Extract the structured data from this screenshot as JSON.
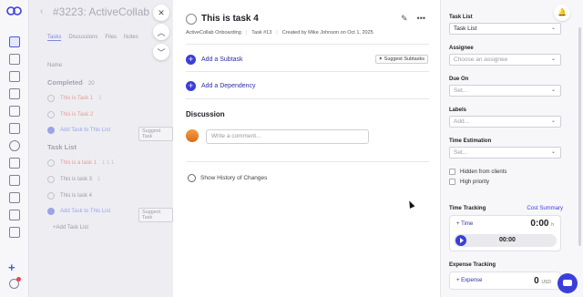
{
  "background_project": {
    "title": "#3223: ActiveCollab ...",
    "tabs": [
      "Tasks",
      "Discussions",
      "Files",
      "Notes"
    ],
    "name_header": "Name",
    "completed_group": {
      "label": "Completed",
      "count": "20"
    },
    "completed_tasks": [
      {
        "name": "This is Task 1",
        "extra": "1"
      },
      {
        "name": "This is Task 2",
        "extra": ""
      }
    ],
    "add_task_label": "Add Task to This List",
    "suggest_label": "Suggest Task",
    "task_list_group": "Task List",
    "list_tasks": [
      {
        "name": "This is a task 1",
        "extra": "1  1  1"
      },
      {
        "name": "This is task 3",
        "extra": "1"
      },
      {
        "name": "This is task 4",
        "extra": ""
      }
    ],
    "add_task_label_2": "Add Task to This List",
    "suggest_label_2": "Suggest Task",
    "add_task_list": "+Add Task List"
  },
  "task": {
    "title": "This is task 4",
    "project": "ActiveCollab Onboarding",
    "number": "Task #13",
    "created": "Created by Mike Johnson on Oct 1, 2025",
    "add_subtask": "Add a Subtask",
    "suggest_subtasks": "Suggest Subtasks",
    "add_dependency": "Add a Dependency",
    "discussion_title": "Discussion",
    "comment_placeholder": "Write a comment...",
    "show_history": "Show History of Changes"
  },
  "sidebar": {
    "task_list_label": "Task List",
    "task_list_value": "Task List",
    "assignee_label": "Assignee",
    "assignee_placeholder": "Choose an assignee",
    "due_on_label": "Due On",
    "due_on_placeholder": "Set...",
    "labels_label": "Labels",
    "labels_placeholder": "Add...",
    "estimation_label": "Time Estimation",
    "estimation_placeholder": "Set...",
    "hidden_from_clients": "Hidden from clients",
    "high_priority": "High priority",
    "time_tracking_label": "Time Tracking",
    "cost_summary": "Cost Summary",
    "time_link": "+ Time",
    "time_total": "0:00",
    "time_unit": "h",
    "timer_value": "00:00",
    "expense_label": "Expense Tracking",
    "expense_link": "+ Expense",
    "expense_total": "0",
    "expense_currency": "USD"
  },
  "colors": {
    "accent": "#3b3fd9",
    "danger": "#e5484d"
  }
}
